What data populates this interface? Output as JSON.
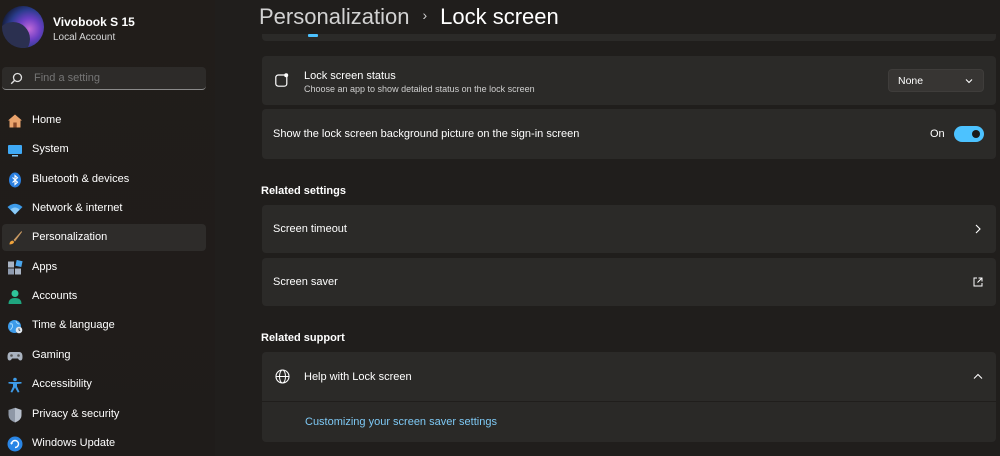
{
  "profile": {
    "name": "Vivobook S 15",
    "account_type": "Local Account"
  },
  "search": {
    "placeholder": "Find a setting"
  },
  "sidebar": {
    "items": [
      {
        "label": "Home",
        "icon": "home-icon"
      },
      {
        "label": "System",
        "icon": "system-icon"
      },
      {
        "label": "Bluetooth & devices",
        "icon": "bluetooth-icon"
      },
      {
        "label": "Network & internet",
        "icon": "wifi-icon"
      },
      {
        "label": "Personalization",
        "icon": "brush-icon",
        "active": true
      },
      {
        "label": "Apps",
        "icon": "apps-icon"
      },
      {
        "label": "Accounts",
        "icon": "accounts-icon"
      },
      {
        "label": "Time & language",
        "icon": "globe-clock-icon"
      },
      {
        "label": "Gaming",
        "icon": "gamepad-icon"
      },
      {
        "label": "Accessibility",
        "icon": "accessibility-icon"
      },
      {
        "label": "Privacy & security",
        "icon": "shield-icon"
      },
      {
        "label": "Windows Update",
        "icon": "update-icon"
      }
    ]
  },
  "breadcrumb": {
    "parent": "Personalization",
    "separator": "›",
    "current": "Lock screen"
  },
  "lock_status": {
    "title": "Lock screen status",
    "description": "Choose an app to show detailed status on the lock screen",
    "selected": "None"
  },
  "signin_background": {
    "title": "Show the lock screen background picture on the sign-in screen",
    "state_label": "On",
    "enabled": true
  },
  "related_settings": {
    "title": "Related settings",
    "items": [
      {
        "label": "Screen timeout"
      },
      {
        "label": "Screen saver"
      }
    ]
  },
  "related_support": {
    "title": "Related support",
    "help_title": "Help with Lock screen",
    "link": "Customizing your screen saver settings"
  },
  "colors": {
    "accent": "#4cc2ff",
    "background": "#201e1c",
    "card": "#2b2a28"
  }
}
